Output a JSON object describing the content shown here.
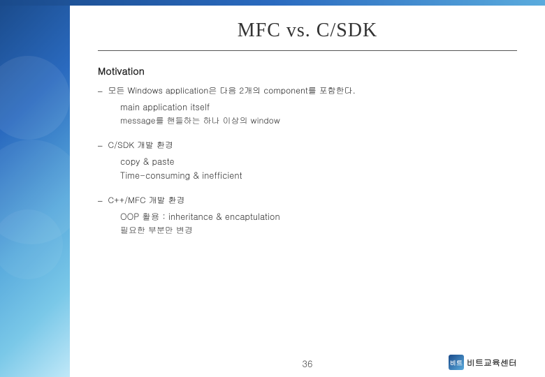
{
  "slide": {
    "title": "MFC vs. C/SDK",
    "page_number": "36"
  },
  "top_section": {
    "heading": "Motivation",
    "bullets": [
      {
        "dash": "–",
        "text": "모든 Windows application은 다음 2개의 component를 포함한다.",
        "sub_items": [
          "main application itself",
          "message를 핸들하는 하나 이상의 window"
        ]
      }
    ]
  },
  "middle_section": {
    "bullets": [
      {
        "dash": "–",
        "text": "C/SDK 개발 환경",
        "sub_items": [
          "copy & paste",
          "Time-consuming & inefficient"
        ]
      }
    ]
  },
  "bottom_section": {
    "bullets": [
      {
        "dash": "–",
        "text": "C++/MFC 개발 환경",
        "sub_items": [
          "OOP 활용 : inheritance & encaptulation",
          "필요한 부분만 변경"
        ]
      }
    ]
  },
  "footer": {
    "page_number": "36",
    "logo_initials": "비트",
    "logo_full": "비트교육센터"
  }
}
